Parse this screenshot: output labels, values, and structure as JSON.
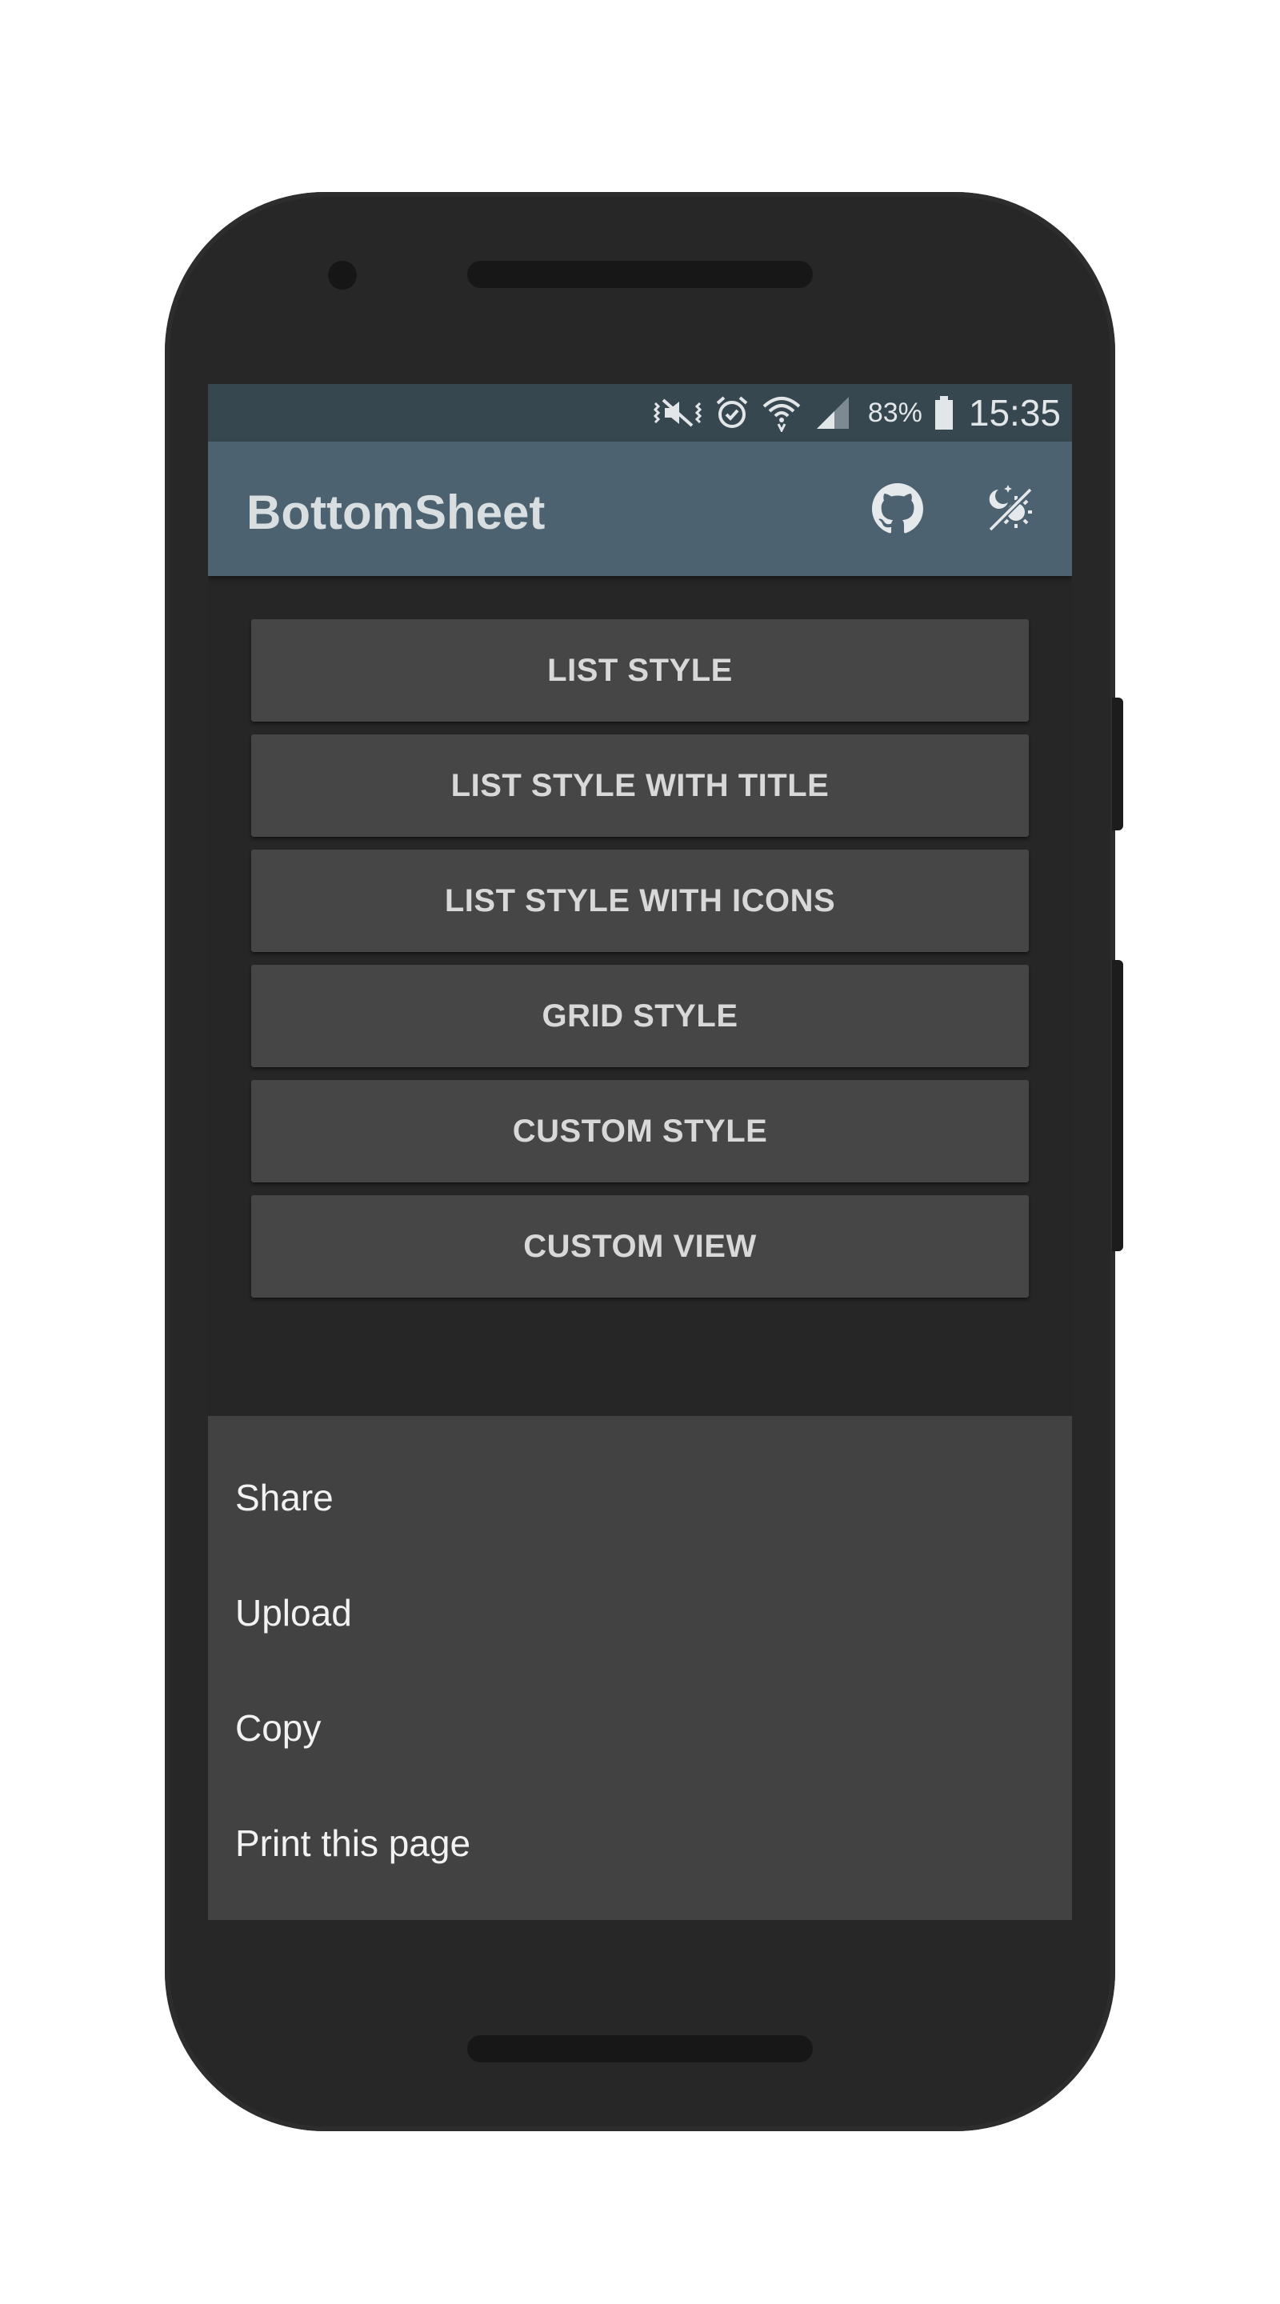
{
  "status_bar": {
    "battery_percent": "83%",
    "time": "15:35",
    "icons": [
      "mute-vibrate-icon",
      "alarm-icon",
      "wifi-icon",
      "signal-icon",
      "battery-icon"
    ]
  },
  "app_bar": {
    "title": "BottomSheet",
    "actions": [
      "github-icon",
      "theme-toggle-icon"
    ]
  },
  "buttons": [
    "LIST STYLE",
    "LIST STYLE WITH TITLE",
    "LIST STYLE WITH ICONS",
    "GRID STYLE",
    "CUSTOM STYLE",
    "CUSTOM VIEW"
  ],
  "bottom_sheet": {
    "items": [
      "Share",
      "Upload",
      "Copy",
      "Print this page"
    ]
  },
  "colors": {
    "status_bar": "#37474f",
    "app_bar": "#4d6270",
    "background": "#262626",
    "button": "#464646",
    "sheet": "#424242"
  }
}
